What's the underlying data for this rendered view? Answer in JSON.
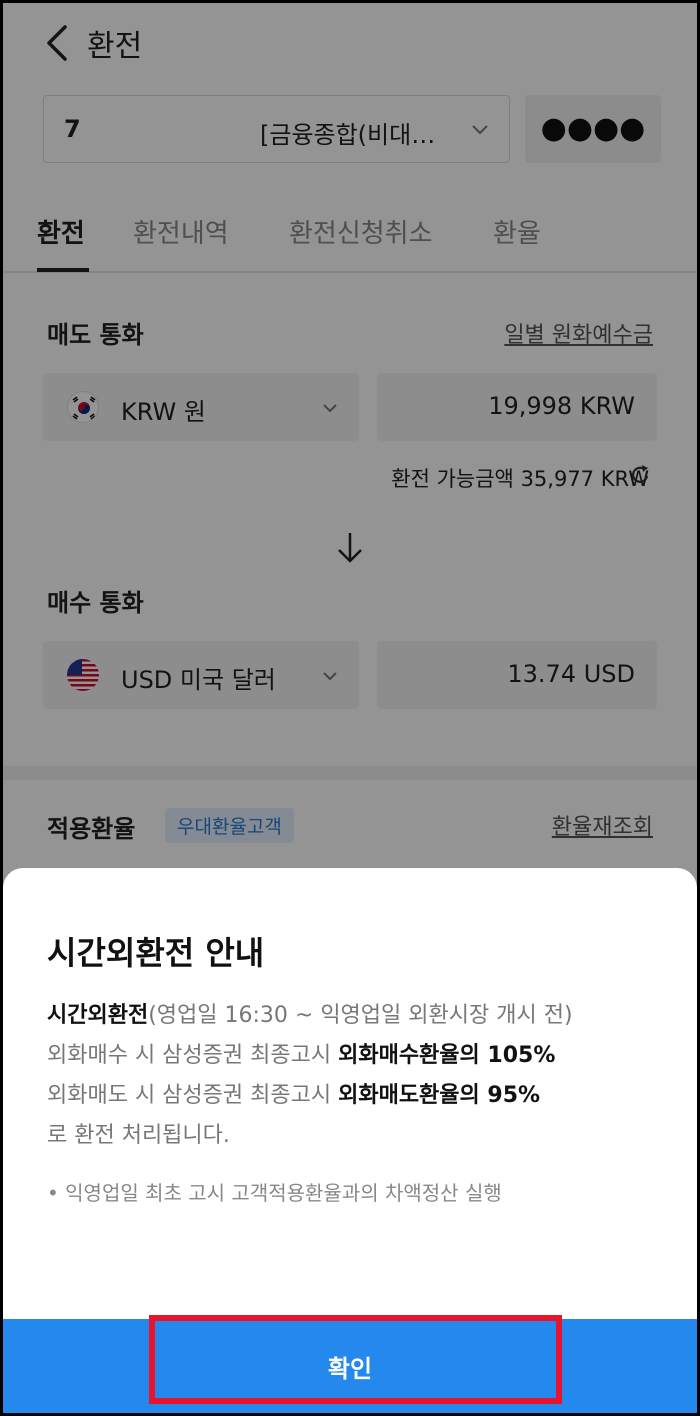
{
  "header": {
    "title": "환전"
  },
  "account": {
    "number": "7",
    "name": "[금융종합(비대…",
    "password_mask": "●●●●"
  },
  "tabs": [
    "환전",
    "환전내역",
    "환전신청취소",
    "환율"
  ],
  "sell": {
    "label": "매도 통화",
    "link": "일별 원화예수금",
    "currency": "KRW 원",
    "amount": "19,998 KRW",
    "available_label": "환전 가능금액",
    "available_amount": "35,977 KRW"
  },
  "buy": {
    "label": "매수 통화",
    "currency": "USD 미국 달러",
    "amount": "13.74 USD"
  },
  "rate": {
    "label": "적용환율",
    "badge": "우대환율고객",
    "link": "환율재조회"
  },
  "modal": {
    "title": "시간외환전 안내",
    "line1_bold": "시간외환전",
    "line1_rest": "(영업일 16:30 ~ 익영업일 외환시장 개시 전)",
    "line2_pre": "외화매수 시 삼성증권 최종고시 ",
    "line2_bold": "외화매수환율의 105%",
    "line3_pre": "외화매도 시 삼성증권 최종고시 ",
    "line3_bold": "외화매도환율의 95%",
    "line4": "로 환전 처리됩니다.",
    "bullet": "• 익영업일 최초 고시 고객적용환율과의 차액정산 실행",
    "confirm": "확인"
  },
  "colors": {
    "primary": "#2488ec",
    "highlight": "#e8142d",
    "badge_text": "#2a7ad6"
  }
}
